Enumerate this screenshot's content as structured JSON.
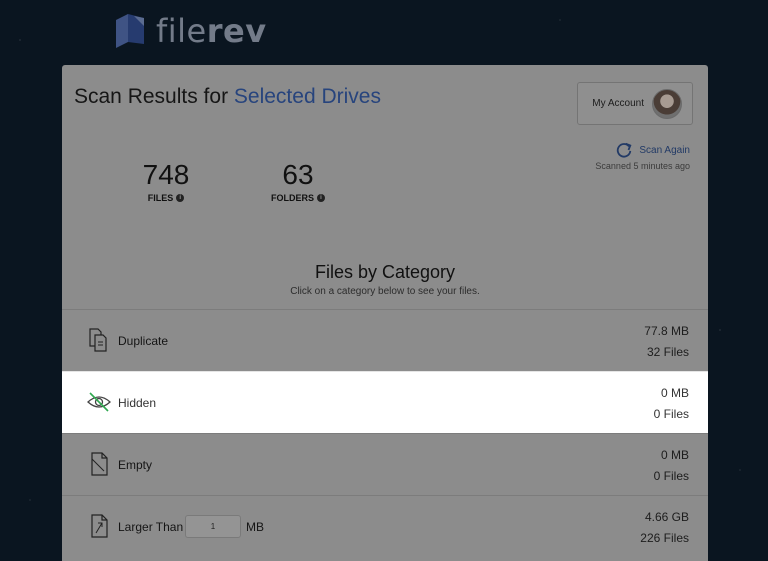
{
  "brand": {
    "name_light": "file",
    "name_bold": "rev"
  },
  "header": {
    "title_prefix": "Scan Results for ",
    "title_accent": "Selected Drives",
    "account_label": "My Account",
    "scan_again_label": "Scan Again",
    "scanned_ago": "Scanned 5 minutes ago"
  },
  "stats": [
    {
      "value": "748",
      "label": "FILES"
    },
    {
      "value": "63",
      "label": "FOLDERS"
    }
  ],
  "section": {
    "title": "Files by Category",
    "subtitle": "Click on a category below to see your files."
  },
  "categories": [
    {
      "name": "Duplicate",
      "size": "77.8 MB",
      "count": "32 Files",
      "icon": "duplicate-file-icon"
    },
    {
      "name": "Hidden",
      "size": "0 MB",
      "count": "0 Files",
      "icon": "hidden-eye-icon"
    },
    {
      "name": "Empty",
      "size": "0 MB",
      "count": "0 Files",
      "icon": "empty-file-icon"
    },
    {
      "name": "Larger Than",
      "size": "4.66 GB",
      "count": "226 Files",
      "icon": "large-file-icon",
      "input_value": "1",
      "unit": "MB"
    }
  ],
  "colors": {
    "accent": "#27447d",
    "highlight_bg": "#ffffff",
    "overlay": "#8c8c8c"
  }
}
